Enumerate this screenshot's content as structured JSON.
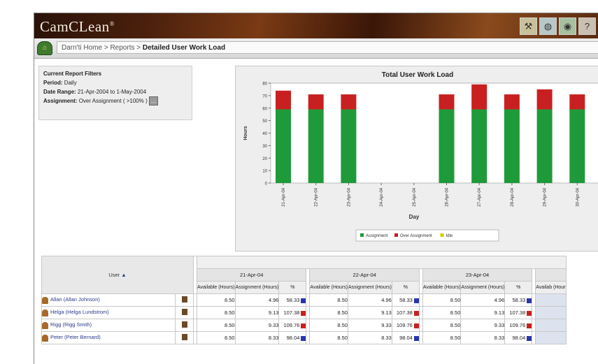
{
  "window": {
    "logo": "CamCLean",
    "logo_mark": "®",
    "top_icons": [
      "tools-icon",
      "globe-icon",
      "eye-icon",
      "help-icon"
    ]
  },
  "breadcrumb": {
    "home": "Darn'ti Home",
    "sep1": " > ",
    "reports": "Reports",
    "sep2": " > ",
    "current": "Detailed User Work Load"
  },
  "filters": {
    "title": "Current Report Filters",
    "period_label": "Period:",
    "period_value": "Daily",
    "range_label": "Date Range:",
    "range_value": "21-Apr-2004 to 1-May-2004",
    "assignment_label": "Assignment:",
    "assignment_value": "Over Assignment ( >100% )"
  },
  "chart_data": {
    "type": "bar",
    "title": "Total User Work Load",
    "xlabel": "Day",
    "ylabel": "Hours",
    "ylim": [
      0,
      80
    ],
    "yticks": [
      "0",
      "10",
      "20",
      "30",
      "40",
      "50",
      "60",
      "70",
      "80"
    ],
    "categories": [
      "21-Apr-04",
      "22-Apr-04",
      "23-Apr-04",
      "24-Apr-04",
      "25-Apr-04",
      "26-Apr-04",
      "27-Apr-04",
      "28-Apr-04",
      "29-Apr-04",
      "30-Apr-04"
    ],
    "series": [
      {
        "name": "Assignment",
        "color": "#1f9a3a",
        "values": [
          59,
          59,
          59,
          0,
          0,
          59,
          59,
          59,
          59,
          59
        ]
      },
      {
        "name": "Over Assignment",
        "color": "#c82020",
        "values": [
          15,
          12,
          12,
          0,
          0,
          12,
          20,
          12,
          16,
          12
        ]
      },
      {
        "name": "Idle",
        "color": "#d8c800",
        "values": [
          0,
          0,
          0,
          0,
          0,
          0,
          0,
          0,
          0,
          0
        ]
      }
    ],
    "legend": "bottom"
  },
  "table": {
    "user_header": "User",
    "sort_arrow": "▲",
    "dates": [
      "21-Apr-04",
      "22-Apr-04",
      "23-Apr-04"
    ],
    "sub_headers": [
      "Available (Hours)",
      "Assignment (Hours)",
      "%"
    ],
    "extra_sub": "Availab (Hour",
    "rows": [
      {
        "name": "Allan (Allan Johnson)",
        "cells": [
          "8.50",
          "4.96",
          "58.33",
          "8.50",
          "4.96",
          "58.33",
          "8.50",
          "4.96",
          "58.33"
        ],
        "flags": [
          "blue",
          "blue",
          "blue"
        ]
      },
      {
        "name": "Helga (Helga Lundstrom)",
        "cells": [
          "8.50",
          "9.13",
          "107.38",
          "8.50",
          "9.13",
          "107.38",
          "8.50",
          "9.13",
          "107.38"
        ],
        "flags": [
          "red",
          "red",
          "red"
        ]
      },
      {
        "name": "Rigg (Rigg Smith)",
        "cells": [
          "8.50",
          "9.33",
          "109.76",
          "8.50",
          "9.33",
          "109.76",
          "8.50",
          "9.33",
          "109.76"
        ],
        "flags": [
          "red",
          "red",
          "red"
        ]
      },
      {
        "name": "Peter (Peter Bernard)",
        "cells": [
          "8.50",
          "8.33",
          "98.04",
          "8.50",
          "8.33",
          "98.04",
          "8.50",
          "8.33",
          "98.04"
        ],
        "flags": [
          "blue",
          "blue",
          "blue"
        ]
      }
    ]
  }
}
